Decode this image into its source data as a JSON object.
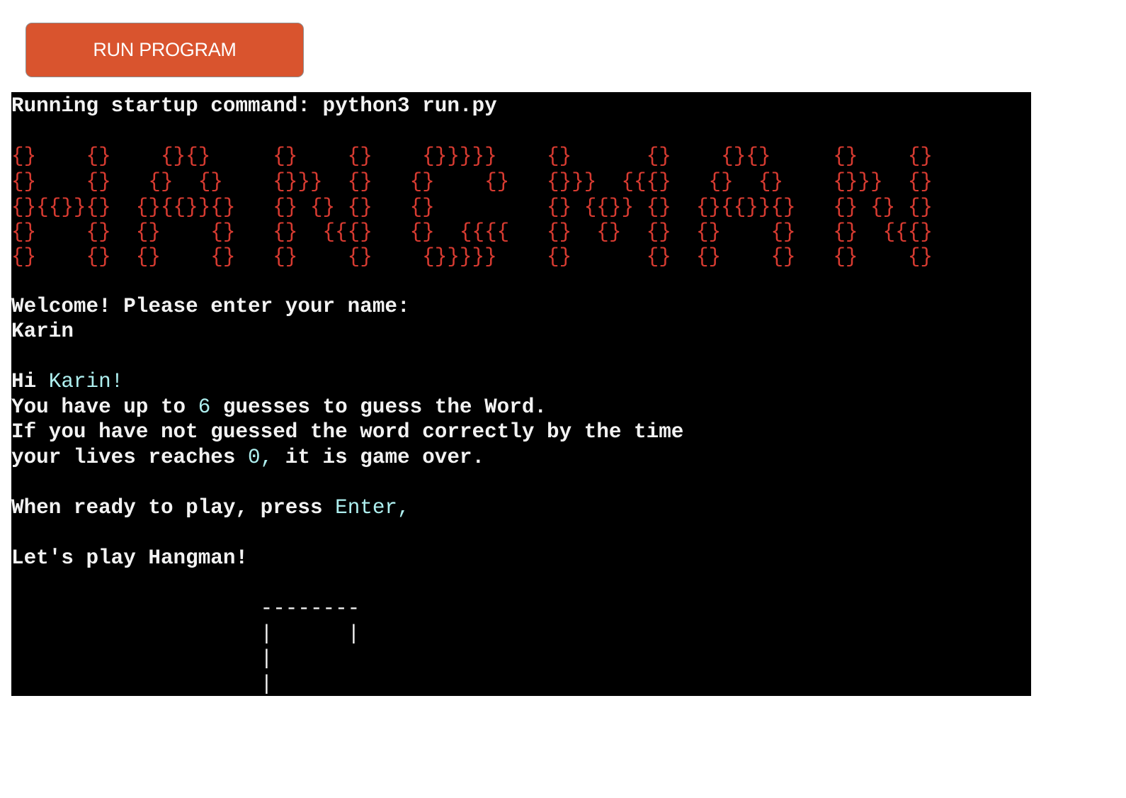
{
  "run_button": {
    "label": "RUN PROGRAM"
  },
  "terminal": {
    "startup": "Running startup command: python3 run.py",
    "title_art": [
      "{}    {}    {}{}     {}    {}    {}}}}}    {}      {}    {}{}     {}    {}",
      "{}    {}   {}  {}    {}}}  {}   {}    {}   {}}}  {{{}   {}  {}    {}}}  {}",
      "{}{{}}{}  {}{{}}{}   {} {} {}   {}         {} {{}} {}  {}{{}}{}   {} {} {}",
      "{}    {}  {}    {}   {}  {{{}   {}  {{{{   {}  {}  {}  {}    {}   {}  {{{}",
      "{}    {}  {}    {}   {}    {}    {}}}}}    {}      {}  {}    {}   {}    {}"
    ],
    "welcome_prompt": "Welcome! Please enter your name:",
    "entered_name": "Karin",
    "greeting_prefix": "Hi ",
    "greeting_name": "Karin!",
    "guesses_prefix": "You have up to ",
    "guesses_count": "6",
    "guesses_suffix": " guesses to guess the Word.",
    "rule_line": "If you have not guessed the word correctly by the time",
    "lives_prefix": "your lives reaches ",
    "lives_value": "0,",
    "lives_suffix": " it is game over.",
    "ready_prefix": "When ready to play, press ",
    "ready_key": "Enter,",
    "lets_play": "Let's play Hangman!",
    "gallows": [
      "                    --------",
      "                    |      |",
      "                    |",
      "                    |"
    ]
  },
  "colors": {
    "button_bg": "#d9542e",
    "terminal_bg": "#000000",
    "text": "#f2f2f2",
    "art": "#d83b31",
    "highlight": "#aeefef"
  }
}
